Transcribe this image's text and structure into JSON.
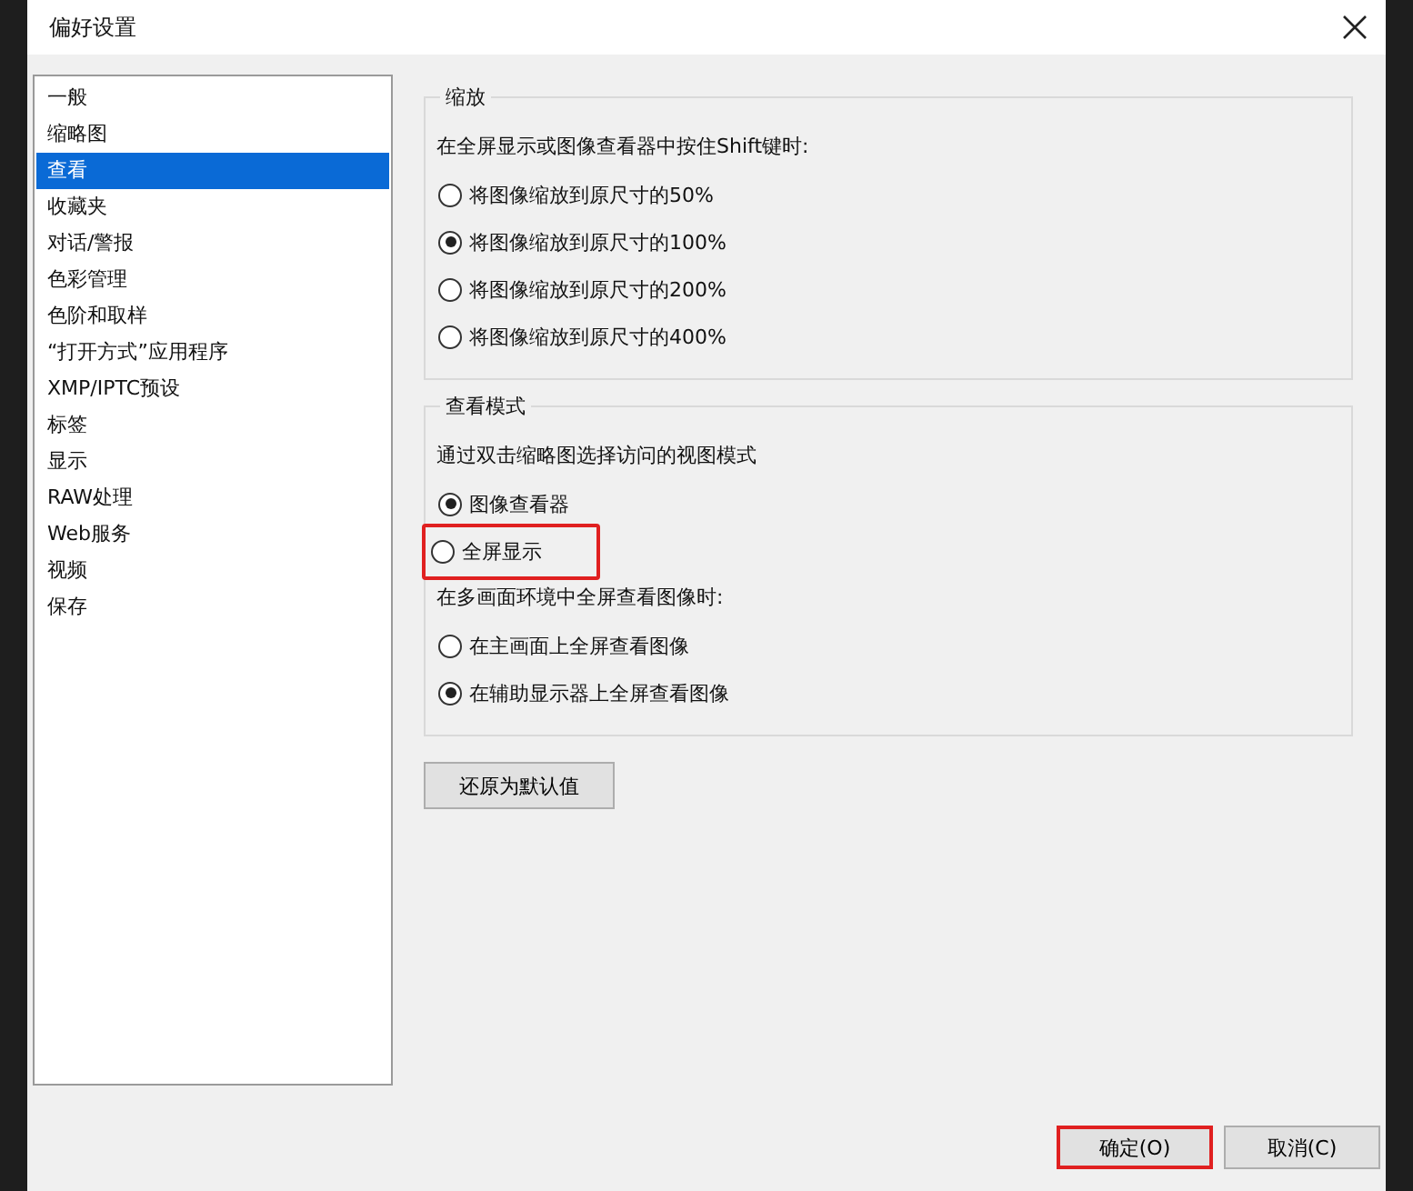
{
  "window": {
    "title": "偏好设置"
  },
  "sidebar": {
    "items": [
      {
        "label": "一般",
        "selected": false
      },
      {
        "label": "缩略图",
        "selected": false
      },
      {
        "label": "查看",
        "selected": true
      },
      {
        "label": "收藏夹",
        "selected": false
      },
      {
        "label": "对话/警报",
        "selected": false
      },
      {
        "label": "色彩管理",
        "selected": false
      },
      {
        "label": "色阶和取样",
        "selected": false
      },
      {
        "label": "“打开方式”应用程序",
        "selected": false
      },
      {
        "label": "XMP/IPTC预设",
        "selected": false
      },
      {
        "label": "标签",
        "selected": false
      },
      {
        "label": "显示",
        "selected": false
      },
      {
        "label": "RAW处理",
        "selected": false
      },
      {
        "label": "Web服务",
        "selected": false
      },
      {
        "label": "视频",
        "selected": false
      },
      {
        "label": "保存",
        "selected": false
      }
    ]
  },
  "groups": [
    {
      "title": "缩放",
      "items": [
        {
          "kind": "text",
          "label": "在全屏显示或图像查看器中按住Shift键时:"
        },
        {
          "kind": "radio",
          "label": "将图像缩放到原尺寸的50%",
          "selected": false,
          "highlighted": false
        },
        {
          "kind": "radio",
          "label": "将图像缩放到原尺寸的100%",
          "selected": true,
          "highlighted": false
        },
        {
          "kind": "radio",
          "label": "将图像缩放到原尺寸的200%",
          "selected": false,
          "highlighted": false
        },
        {
          "kind": "radio",
          "label": "将图像缩放到原尺寸的400%",
          "selected": false,
          "highlighted": false
        }
      ]
    },
    {
      "title": "查看模式",
      "items": [
        {
          "kind": "text",
          "label": "通过双击缩略图选择访问的视图模式"
        },
        {
          "kind": "radio",
          "label": "图像查看器",
          "selected": true,
          "highlighted": false
        },
        {
          "kind": "radio",
          "label": "全屏显示",
          "selected": false,
          "highlighted": true
        },
        {
          "kind": "text",
          "label": "在多画面环境中全屏查看图像时:"
        },
        {
          "kind": "radio",
          "label": "在主画面上全屏查看图像",
          "selected": false,
          "highlighted": false
        },
        {
          "kind": "radio",
          "label": "在辅助显示器上全屏查看图像",
          "selected": true,
          "highlighted": false
        }
      ]
    }
  ],
  "reset_button": "还原为默认值",
  "buttons": [
    {
      "label": "确定(O)",
      "highlighted": true
    },
    {
      "label": "取消(C)",
      "highlighted": false
    }
  ]
}
